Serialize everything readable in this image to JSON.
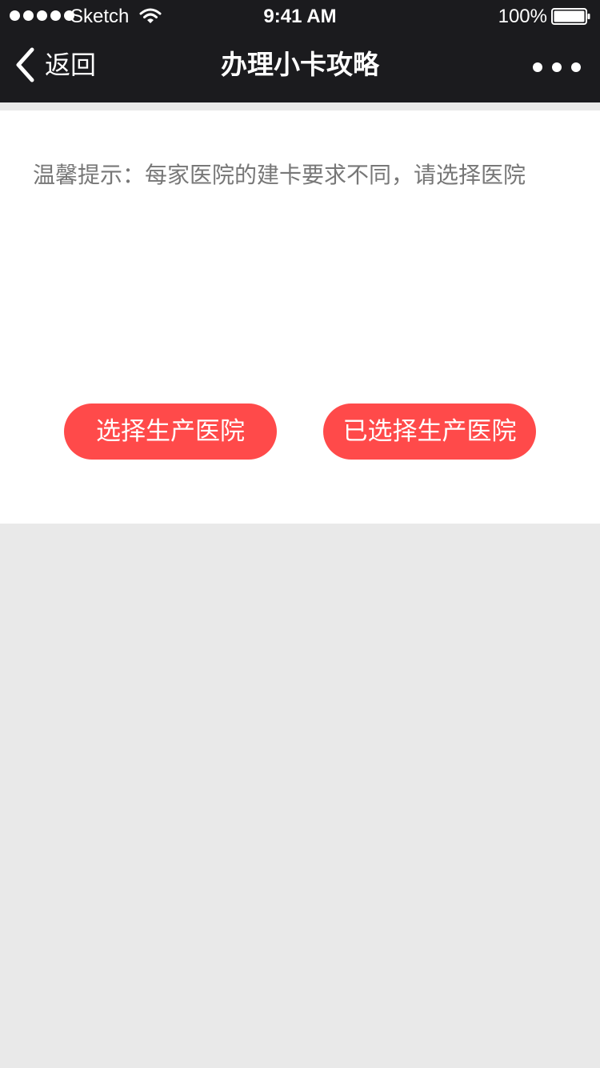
{
  "status_bar": {
    "carrier": "Sketch",
    "time": "9:41 AM",
    "battery_percent": "100%",
    "icons": [
      "signal-dots",
      "wifi-icon",
      "battery-icon"
    ]
  },
  "nav_bar": {
    "back_label": "返回",
    "title": "办理小卡攻略",
    "more_icon": "more-dots-icon"
  },
  "content": {
    "tip": "温馨提示：每家医院的建卡要求不同，请选择医院",
    "buttons": {
      "select_hospital": "选择生产医院",
      "selected_hospital": "已选择生产医院"
    }
  },
  "colors": {
    "bar_background": "#1b1b1e",
    "accent": "#ff4a4a",
    "page_background": "#e9e9e9",
    "tip_text": "#777777"
  }
}
